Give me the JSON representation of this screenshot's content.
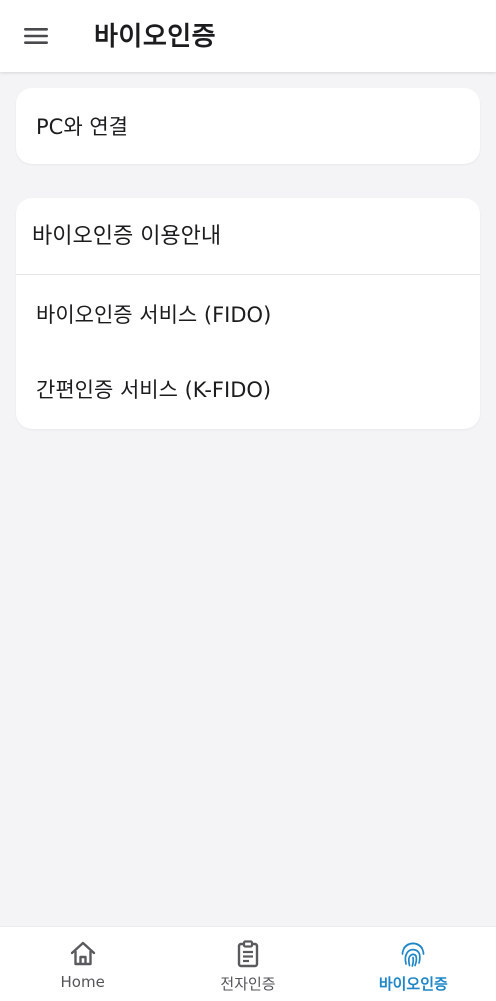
{
  "app_bar": {
    "title": "바이오인증",
    "menu_icon": "hamburger-menu-icon"
  },
  "pc_card": {
    "label": "PC와 연결"
  },
  "guide_card": {
    "title": "바이오인증 이용안내",
    "items": [
      {
        "label": "바이오인증 서비스 (FIDO)"
      },
      {
        "label": "간편인증 서비스 (K-FIDO)"
      }
    ]
  },
  "bottom_nav": {
    "items": [
      {
        "label": "Home",
        "icon": "home-icon",
        "active": false
      },
      {
        "label": "전자인증",
        "icon": "clipboard-icon",
        "active": false
      },
      {
        "label": "바이오인증",
        "icon": "fingerprint-icon",
        "active": true
      }
    ]
  },
  "colors": {
    "accent": "#1f86c8",
    "background": "#f4f3f6",
    "surface": "#ffffff"
  }
}
